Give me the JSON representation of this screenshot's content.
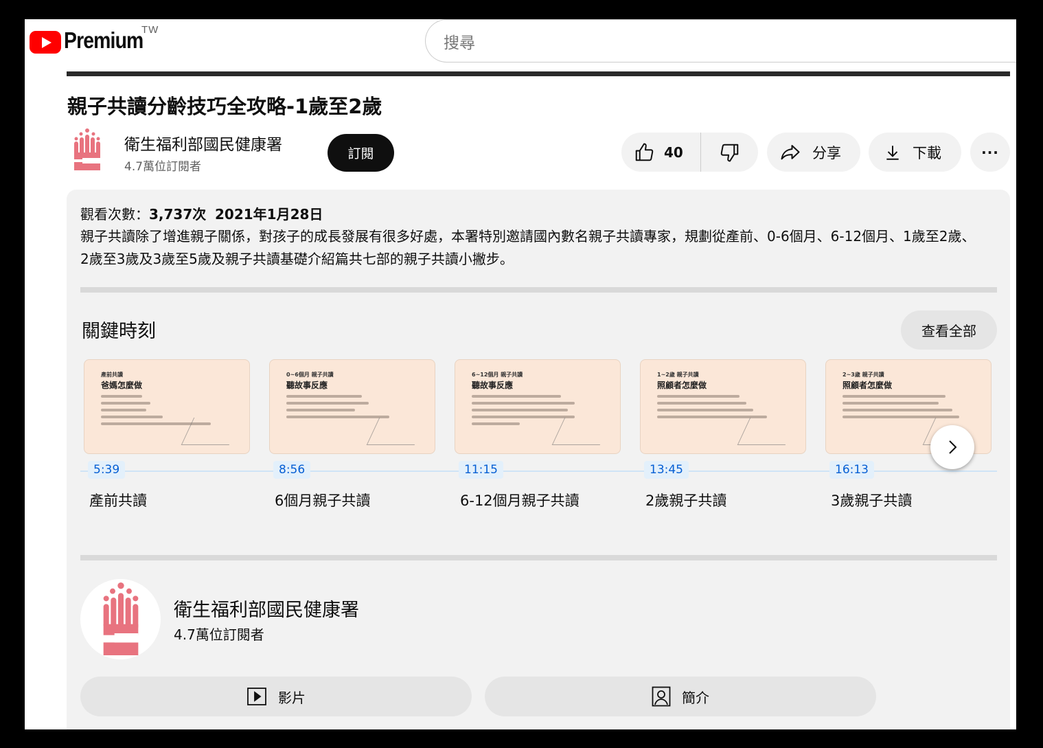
{
  "header": {
    "logo_text": "Premium",
    "region": "TW",
    "search_placeholder": "搜尋"
  },
  "video": {
    "title": "親子共讀分齡技巧全攻略-1歲至2歲"
  },
  "channel": {
    "name": "衛生福利部國民健康署",
    "subscribers": "4.7萬位訂閱者",
    "subscribe_label": "訂閱"
  },
  "actions": {
    "like_count": "40",
    "share_label": "分享",
    "download_label": "下載"
  },
  "description": {
    "views_label": "觀看次數：",
    "views": "3,737次",
    "date": "2021年1月28日",
    "text": "親子共讀除了增進親子關係，對孩子的成長發展有很多好處，本署特別邀請國內數名親子共讀專家，規劃從產前、0-6個月、6-12個月、1歲至2歲、2歲至3歲及3歲至5歲及親子共讀基礎介紹篇共七部的親子共讀小撇步。"
  },
  "key_moments": {
    "title": "關鍵時刻",
    "view_all_label": "查看全部",
    "chapters": [
      {
        "time": "5:39",
        "label": "產前共讀",
        "thumb_small": "產前共讀",
        "thumb_big": "爸媽怎麼做"
      },
      {
        "time": "8:56",
        "label": "6個月親子共讀",
        "thumb_small": "0~6個月 親子共讀",
        "thumb_big": "聽故事反應"
      },
      {
        "time": "11:15",
        "label": "6-12個月親子共讀",
        "thumb_small": "6~12個月 親子共讀",
        "thumb_big": "聽故事反應"
      },
      {
        "time": "13:45",
        "label": "2歲親子共讀",
        "thumb_small": "1~2歲 親子共讀",
        "thumb_big": "照顧者怎麼做"
      },
      {
        "time": "16:13",
        "label": "3歲親子共讀",
        "thumb_small": "2~3歲 親子共讀",
        "thumb_big": "照顧者怎麼做"
      }
    ]
  },
  "bottom": {
    "channel_name": "衛生福利部國民健康署",
    "subscribers": "4.7萬位訂閱者",
    "videos_label": "影片",
    "about_label": "簡介"
  },
  "colors": {
    "brand_red": "#ff0000",
    "channel_pink": "#e8737f",
    "timestamp_blue": "#065fd4"
  },
  "icons": [
    "youtube-logo-icon",
    "like-icon",
    "dislike-icon",
    "share-icon",
    "download-icon",
    "more-icon",
    "chevron-right-icon",
    "video-play-icon",
    "profile-icon",
    "channel-hand-icon"
  ]
}
